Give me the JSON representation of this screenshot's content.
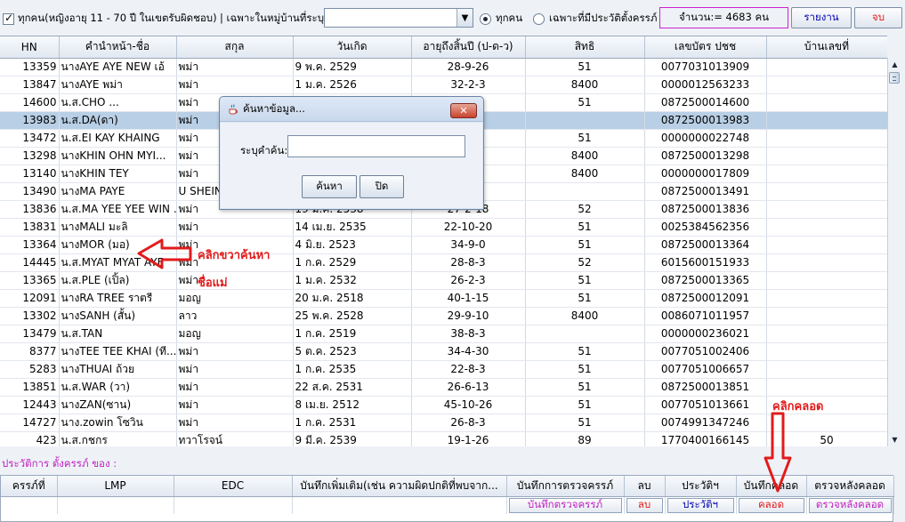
{
  "toolbar": {
    "filter_checkbox_label": "ทุกคน(หญิงอายุ 11 - 70 ปี ในเขตรับผิดชอบ)",
    "village_label": "| เฉพาะในหมู่บ้านที่ระบุ:",
    "village_combo_value": "",
    "radio_all_label": "ทุกคน",
    "radio_history_label": "เฉพาะที่มีประวัติตั้งครรภ์",
    "count_text": "จำนวน:= 4683 คน",
    "report_button": "รายงาน",
    "close_button": "จบ",
    "count_border_color": "#d01fd0",
    "close_text_color": "#e11b1b",
    "report_text_color": "#0000b0"
  },
  "table": {
    "columns": [
      "HN",
      "คำนำหน้า-ชื่อ",
      "สกุล",
      "วันเกิด",
      "อายุถึงสิ้นปี (ป-ด-ว)",
      "สิทธิ",
      "เลขบัตร ปชช",
      "บ้านเลขที่"
    ],
    "selected_row_color": "#b8cfe5",
    "rows": [
      {
        "hn": "13359",
        "name": "นางAYE AYE NEW เอ้",
        "surname": "พม่า",
        "dob": "9 พ.ค. 2529",
        "age": "28-9-26",
        "right": "51",
        "cid": "0077031013909",
        "house": ""
      },
      {
        "hn": "13847",
        "name": "นางAYE พม่า",
        "surname": "พม่า",
        "dob": "1 ม.ค. 2526",
        "age": "32-2-3",
        "right": "8400",
        "cid": "0000012563233",
        "house": ""
      },
      {
        "hn": "14600",
        "name": "น.ส.CHO ...",
        "surname": "พม่า",
        "dob": "",
        "age": "8",
        "right": "51",
        "cid": "0872500014600",
        "house": ""
      },
      {
        "hn": "13983",
        "name": "น.ส.DA(ดา)",
        "surname": "พม่า",
        "dob": "",
        "age": "8",
        "right": "",
        "cid": "0872500013983",
        "house": ""
      },
      {
        "hn": "13472",
        "name": "น.ส.EI KAY KHAING",
        "surname": "พม่า",
        "dob": "",
        "age": "8",
        "right": "51",
        "cid": "0000000022748",
        "house": ""
      },
      {
        "hn": "13298",
        "name": "นางKHIN OHN MYI...",
        "surname": "พม่า",
        "dob": "",
        "age": "5",
        "right": "8400",
        "cid": "0872500013298",
        "house": ""
      },
      {
        "hn": "13140",
        "name": "นางKHIN TEY",
        "surname": "พม่า",
        "dob": "",
        "age": "",
        "right": "8400",
        "cid": "0000000017809",
        "house": ""
      },
      {
        "hn": "13490",
        "name": "นางMA PAYE",
        "surname": "U SHEIN",
        "dob": "",
        "age": "9",
        "right": "",
        "cid": "0872500013491",
        "house": ""
      },
      {
        "hn": "13836",
        "name": "น.ส.MA YEE YEE WIN ...",
        "surname": "พม่า",
        "dob": "19 ม.ค. 2538",
        "age": "27-2-18",
        "right": "52",
        "cid": "0872500013836",
        "house": ""
      },
      {
        "hn": "13831",
        "name": "นางMALI มะลิ",
        "surname": "พม่า",
        "dob": "14 เม.ย. 2535",
        "age": "22-10-20",
        "right": "51",
        "cid": "0025384562356",
        "house": ""
      },
      {
        "hn": "13364",
        "name": "นางMOR (มอ)",
        "surname": "พม่า",
        "dob": "4 มิ.ย. 2523",
        "age": "34-9-0",
        "right": "51",
        "cid": "0872500013364",
        "house": ""
      },
      {
        "hn": "14445",
        "name": "น.ส.MYAT MYAT AYE",
        "surname": "พม่า",
        "dob": "1 ก.ค. 2529",
        "age": "28-8-3",
        "right": "52",
        "cid": "6015600151933",
        "house": ""
      },
      {
        "hn": "13365",
        "name": "น.ส.PLE (เปิ้ล)",
        "surname": "พม่า",
        "dob": "1 ม.ค. 2532",
        "age": "26-2-3",
        "right": "51",
        "cid": "0872500013365",
        "house": ""
      },
      {
        "hn": "12091",
        "name": "นางRA TREE ราตรี",
        "surname": "มอญ",
        "dob": "20 ม.ค. 2518",
        "age": "40-1-15",
        "right": "51",
        "cid": "0872500012091",
        "house": ""
      },
      {
        "hn": "13302",
        "name": "นางSANH (สั้น)",
        "surname": "ลาว",
        "dob": "25 พ.ค. 2528",
        "age": "29-9-10",
        "right": "8400",
        "cid": "0086071011957",
        "house": ""
      },
      {
        "hn": "13479",
        "name": "น.ส.TAN",
        "surname": "มอญ",
        "dob": "1 ก.ค. 2519",
        "age": "38-8-3",
        "right": "",
        "cid": "0000000236021",
        "house": ""
      },
      {
        "hn": "8377",
        "name": "นางTEE TEE KHAI (ที...",
        "surname": "พม่า",
        "dob": "5 ต.ค. 2523",
        "age": "34-4-30",
        "right": "51",
        "cid": "0077051002406",
        "house": ""
      },
      {
        "hn": "5283",
        "name": "นางTHUAI ถ้วย",
        "surname": "พม่า",
        "dob": "1 ก.ค. 2535",
        "age": "22-8-3",
        "right": "51",
        "cid": "0077051006657",
        "house": ""
      },
      {
        "hn": "13851",
        "name": "น.ส.WAR (วา)",
        "surname": "พม่า",
        "dob": "22 ส.ค. 2531",
        "age": "26-6-13",
        "right": "51",
        "cid": "0872500013851",
        "house": ""
      },
      {
        "hn": "12443",
        "name": "นางZAN(ซาน)",
        "surname": "พม่า",
        "dob": "8 เม.ย. 2512",
        "age": "45-10-26",
        "right": "51",
        "cid": "0077051013661",
        "house": ""
      },
      {
        "hn": "14727",
        "name": "นาง.zowin โซวิน",
        "surname": "พม่า",
        "dob": "1 ก.ค. 2531",
        "age": "26-8-3",
        "right": "51",
        "cid": "0074991347246",
        "house": ""
      },
      {
        "hn": "423",
        "name": "น.ส.กชกร",
        "surname": "ทวาโรจน์",
        "dob": "9 มี.ค. 2539",
        "age": "19-1-26",
        "right": "89",
        "cid": "1770400166145",
        "house": "50"
      }
    ]
  },
  "history": {
    "label": "ประวัติการ ตั้งครรภ์ ของ :",
    "label_color": "#c01fc0",
    "columns": [
      "ครรภ์ที่",
      "LMP",
      "EDC",
      "บันทึกเพิ่มเติม(เช่น ความผิดปกติที่พบจาก...",
      "บันทึกการตรวจครรภ์",
      "ลบ",
      "ประวัติฯ",
      "บันทึกคลอด",
      "ตรวจหลังคลอด"
    ],
    "buttons": {
      "anc": "บันทึกตรวจครรภ์",
      "delete": "ลบ",
      "history": "ประวัติฯ",
      "delivery": "คลอด",
      "postnatal": "ตรวจหลังคลอด"
    },
    "button_colors": {
      "anc": "#c01fc0",
      "delete": "#e11b1b",
      "history": "#0000b0",
      "delivery": "#e11b1b",
      "postnatal": "#c01fc0"
    }
  },
  "dialog": {
    "title": "ค้นหาข้อมูล...",
    "field_label": "ระบุคำค้น:",
    "field_value": "",
    "search_button": "ค้นหา",
    "close_button": "ปิด",
    "close_icon": "x-icon"
  },
  "annotations": {
    "right_click_text_1": "คลิกขวาค้นหา",
    "right_click_text_2": "ชื่อแม่",
    "click_delivery_text": "คลิกคลอด",
    "color": "#e11b1b"
  }
}
